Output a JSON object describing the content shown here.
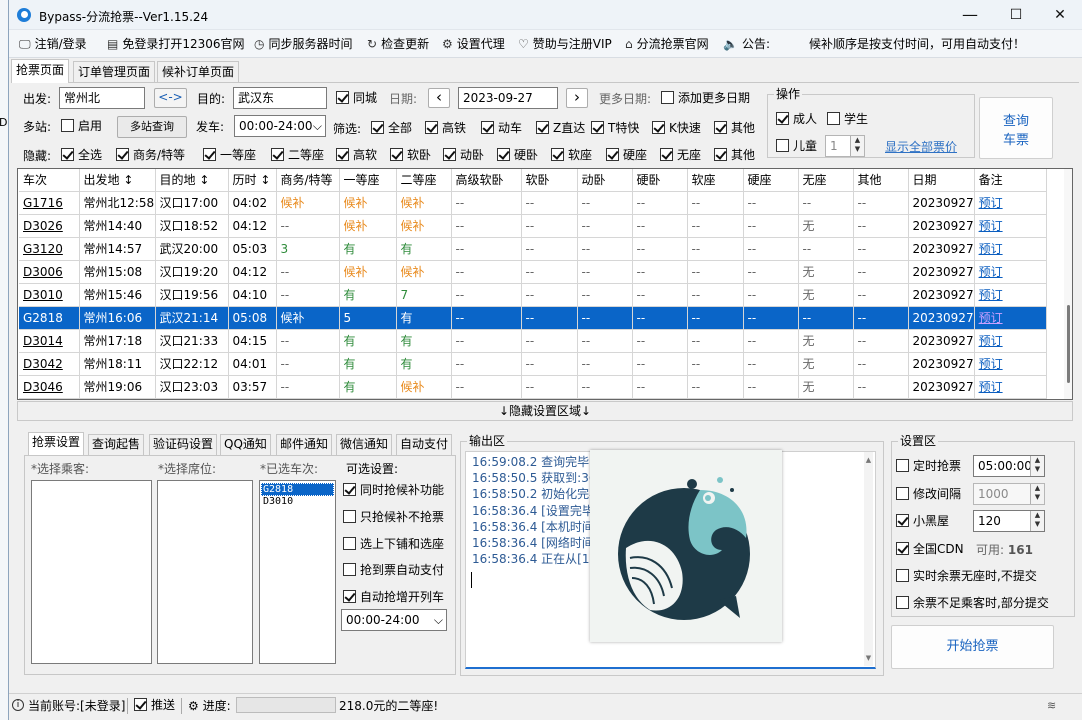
{
  "window": {
    "title": "Bypass-分流抢票--Ver1.15.24",
    "minimize": "—",
    "maximize": "☐",
    "close": "✕"
  },
  "edge_text": "De",
  "menu": [
    {
      "icon": "🖵",
      "label": "注销/登录"
    },
    {
      "icon": "▤",
      "label": "免登录打开12306官网"
    },
    {
      "icon": "◷",
      "label": "同步服务器时间"
    },
    {
      "icon": "↻",
      "label": "检查更新"
    },
    {
      "icon": "⚙",
      "label": "设置代理"
    },
    {
      "icon": "♡",
      "label": "赞助与注册VIP"
    },
    {
      "icon": "⌂",
      "label": "分流抢票官网"
    },
    {
      "icon": "🔈",
      "label": "公告:"
    }
  ],
  "announcement": "候补顺序是按支付时间，可用自动支付！",
  "tabs": [
    "抢票页面",
    "订单管理页面",
    "候补订单页面"
  ],
  "search": {
    "from_label": "出发:",
    "from_value": "常州北",
    "swap": "<->",
    "to_label": "目的:",
    "to_value": "武汉东",
    "same_city": "同城",
    "date_label": "日期:",
    "date_value": "2023-09-27",
    "prev": "‹",
    "next": "›",
    "more_dates_label": "更多日期:",
    "add_more_dates": "添加更多日期",
    "multi_label": "多站:",
    "multi_enable": "启用",
    "multi_query": "多站查询",
    "depart_label": "发车:",
    "depart_value": "00:00-24:00",
    "filter_label": "筛选:",
    "filters": [
      "全部",
      "高铁",
      "动车",
      "Z直达",
      "T特快",
      "K快速",
      "其他"
    ],
    "hide_label": "隐藏:",
    "hide": [
      "全选",
      "商务/特等",
      "一等座",
      "二等座",
      "高软",
      "软卧",
      "动卧",
      "硬卧",
      "软座",
      "硬座",
      "无座",
      "其他"
    ]
  },
  "ops": {
    "title": "操作",
    "adult": "成人",
    "student": "学生",
    "child": "儿童",
    "child_count": "1",
    "show_prices": "显示全部票价",
    "query_line1": "查询",
    "query_line2": "车票"
  },
  "table": {
    "headers": [
      "车次",
      "出发地 ↕",
      "目的地 ↕",
      "历时 ↕",
      "商务/特等",
      "一等座",
      "二等座",
      "高级软卧",
      "软卧",
      "动卧",
      "硬卧",
      "软座",
      "硬座",
      "无座",
      "其他",
      "日期",
      "备注"
    ],
    "rows": [
      {
        "cells": [
          "G1716",
          "常州北12:58",
          "汉口17:00",
          "04:02",
          "候补",
          "候补",
          "候补",
          "--",
          "--",
          "--",
          "--",
          "--",
          "--",
          "--",
          "--",
          "20230927",
          "预订"
        ]
      },
      {
        "cells": [
          "D3026",
          "常州14:40",
          "汉口18:52",
          "04:12",
          "--",
          "候补",
          "候补",
          "--",
          "--",
          "--",
          "--",
          "--",
          "--",
          "无",
          "--",
          "20230927",
          "预订"
        ]
      },
      {
        "cells": [
          "G3120",
          "常州14:57",
          "武汉20:00",
          "05:03",
          "3",
          "有",
          "有",
          "--",
          "--",
          "--",
          "--",
          "--",
          "--",
          "--",
          "--",
          "20230927",
          "预订"
        ]
      },
      {
        "cells": [
          "D3006",
          "常州15:08",
          "汉口19:20",
          "04:12",
          "--",
          "候补",
          "候补",
          "--",
          "--",
          "--",
          "--",
          "--",
          "--",
          "无",
          "--",
          "20230927",
          "预订"
        ]
      },
      {
        "cells": [
          "D3010",
          "常州15:46",
          "汉口19:56",
          "04:10",
          "--",
          "有",
          "7",
          "--",
          "--",
          "--",
          "--",
          "--",
          "--",
          "无",
          "--",
          "20230927",
          "预订"
        ]
      },
      {
        "cells": [
          "G2818",
          "常州16:06",
          "武汉21:14",
          "05:08",
          "候补",
          "5",
          "有",
          "--",
          "--",
          "--",
          "--",
          "--",
          "--",
          "--",
          "--",
          "20230927",
          "预订"
        ]
      },
      {
        "cells": [
          "D3014",
          "常州17:18",
          "汉口21:33",
          "04:15",
          "--",
          "有",
          "有",
          "--",
          "--",
          "--",
          "--",
          "--",
          "--",
          "无",
          "--",
          "20230927",
          "预订"
        ]
      },
      {
        "cells": [
          "D3042",
          "常州18:11",
          "汉口22:12",
          "04:01",
          "--",
          "有",
          "有",
          "--",
          "--",
          "--",
          "--",
          "--",
          "--",
          "无",
          "--",
          "20230927",
          "预订"
        ]
      },
      {
        "cells": [
          "D3046",
          "常州19:06",
          "汉口23:03",
          "03:57",
          "--",
          "有",
          "候补",
          "--",
          "--",
          "--",
          "--",
          "--",
          "--",
          "无",
          "--",
          "20230927",
          "预订"
        ]
      }
    ]
  },
  "splitter": "↓隐藏设置区域↓",
  "bottom_tabs": [
    "抢票设置",
    "查询起售",
    "验证码设置",
    "QQ通知",
    "邮件通知",
    "微信通知",
    "自动支付"
  ],
  "passengers_label": "*选择乘客:",
  "seats_label": "*选择席位:",
  "chosen_label": "*已选车次:",
  "chosen": [
    "G2818",
    "D3010"
  ],
  "options_label": "可选设置:",
  "options": [
    {
      "label": "同时抢候补功能",
      "on": true
    },
    {
      "label": "只抢候补不抢票",
      "on": false
    },
    {
      "label": "选上下铺和选座",
      "on": false
    },
    {
      "label": "抢到票自动支付",
      "on": false
    },
    {
      "label": "自动抢增开列车",
      "on": true
    }
  ],
  "auto_time": "00:00-24:00",
  "output_label": "输出区",
  "output": [
    "16:59:08.2  查询完毕,",
    "16:58:50.5  获取到:36",
    "16:58:50.2  初始化完毕",
    "16:58:36.4  [设置完毕]",
    "16:58:36.4  [本机时间]",
    "16:58:36.4  [网络时间]",
    "16:58:36.4  正在从[1]号"
  ],
  "settings": {
    "title": "设置区",
    "timed": "定时抢票",
    "timed_value": "05:00:00",
    "interval": "修改间隔",
    "interval_value": "1000",
    "blackroom": "小黑屋",
    "blackroom_value": "120",
    "cdn": "全国CDN",
    "cdn_avail_label": "可用:",
    "cdn_avail": "161",
    "realtime": "实时余票无座时,不提交",
    "partial": "余票不足乘客时,部分提交",
    "start": "开始抢票"
  },
  "status": {
    "account": "当前账号:[未登录]",
    "push": "推送",
    "progress_label": "进度:",
    "message": "218.0元的二等座!"
  },
  "colors": {
    "accent": "#0a65c8",
    "waitlist": "#e8891b",
    "available": "#2e8b3a"
  }
}
